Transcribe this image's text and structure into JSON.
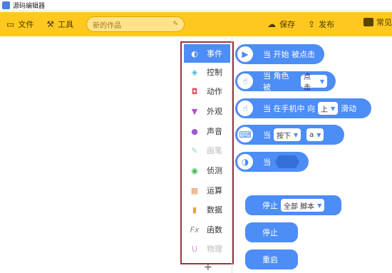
{
  "titlebar": {
    "title": "源码编辑器"
  },
  "toolbar": {
    "file": "文件",
    "tools": "工具",
    "project_name": "新的作品",
    "save": "保存",
    "publish": "发布",
    "help": "常见"
  },
  "categories": [
    {
      "label": "事件",
      "icon": "toggle-icon",
      "active": true
    },
    {
      "label": "控制",
      "icon": "gamepad-icon"
    },
    {
      "label": "动作",
      "icon": "monster-icon"
    },
    {
      "label": "外观",
      "icon": "shirt-icon"
    },
    {
      "label": "声音",
      "icon": "mic-icon"
    },
    {
      "label": "画笔",
      "icon": "pen-icon",
      "dim": true
    },
    {
      "label": "侦测",
      "icon": "radar-icon"
    },
    {
      "label": "运算",
      "icon": "calc-icon"
    },
    {
      "label": "数据",
      "icon": "bars-icon"
    },
    {
      "label": "函数",
      "icon": "fx-icon"
    },
    {
      "label": "物理",
      "icon": "magnet-icon",
      "dim": true
    }
  ],
  "blocks": {
    "start": "当 开始 被点击",
    "role_prefix": "当 角色 被",
    "role_dd": "点击",
    "phone_prefix": "当 在手机中 向",
    "phone_dd": "上",
    "phone_suffix": "滑动",
    "key_prefix": "当",
    "key_dd": "按下",
    "key_dd2": "a",
    "when_prefix": "当",
    "stop_prefix": "停止",
    "stop_dd": "全部 脚本",
    "stop": "停止",
    "restart": "重启"
  },
  "colors": {
    "toolbar": "#ffc81e",
    "block": "#4c8df6",
    "highlight": "#a03040"
  }
}
